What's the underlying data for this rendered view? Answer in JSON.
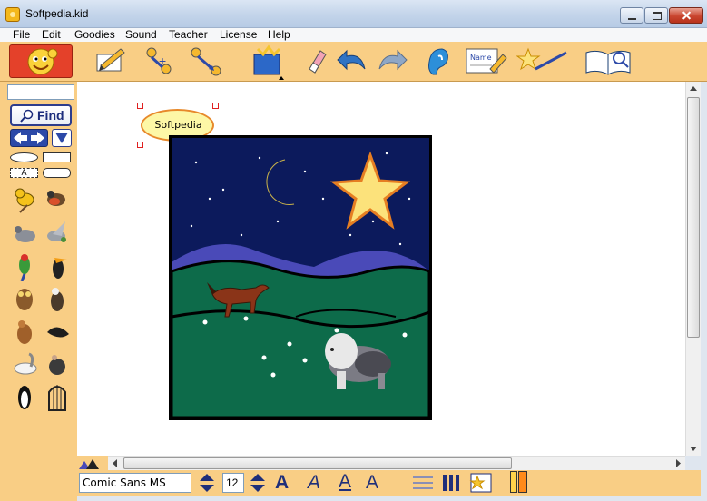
{
  "window": {
    "title": "Softpedia.kid",
    "minimize_icon": "minimize-icon",
    "maximize_icon": "maximize-icon",
    "close_icon": "close-icon"
  },
  "menu": [
    "File",
    "Edit",
    "Goodies",
    "Sound",
    "Teacher",
    "License",
    "Help"
  ],
  "toolbar": {
    "tools": [
      "pencil-paper-icon",
      "connect-nodes-icon",
      "link-arrow-icon",
      "treasure-box-icon",
      "eraser-icon",
      "undo-arrow-icon",
      "redo-arrow-icon",
      "ear-icon",
      "name-tag-icon",
      "magic-wand-icon",
      "book-search-icon"
    ],
    "name_tag_text": "Name"
  },
  "sidebar": {
    "find_label": "Find",
    "shapes_label": "A",
    "stickers": [
      "canary-icon",
      "robin-icon",
      "pigeon-icon",
      "dove-icon",
      "parrot-icon",
      "toucan-icon",
      "owl-icon",
      "eagle-icon",
      "hawk-icon",
      "crow-icon",
      "swan-icon",
      "vulture-icon",
      "penguin-icon",
      "birdcage-icon"
    ]
  },
  "canvas": {
    "callout_text": "Softpedia",
    "picture": "night-landscape-horse-dog-picture"
  },
  "bottom": {
    "font": "Comic Sans MS",
    "size": "12",
    "style_buttons": [
      "bold-a-icon",
      "italic-a-icon",
      "underline-a-icon",
      "font-color-a-icon"
    ],
    "style_label": "A",
    "colors": {
      "left": "#ffd24a",
      "right": "#ff8a1a"
    }
  }
}
